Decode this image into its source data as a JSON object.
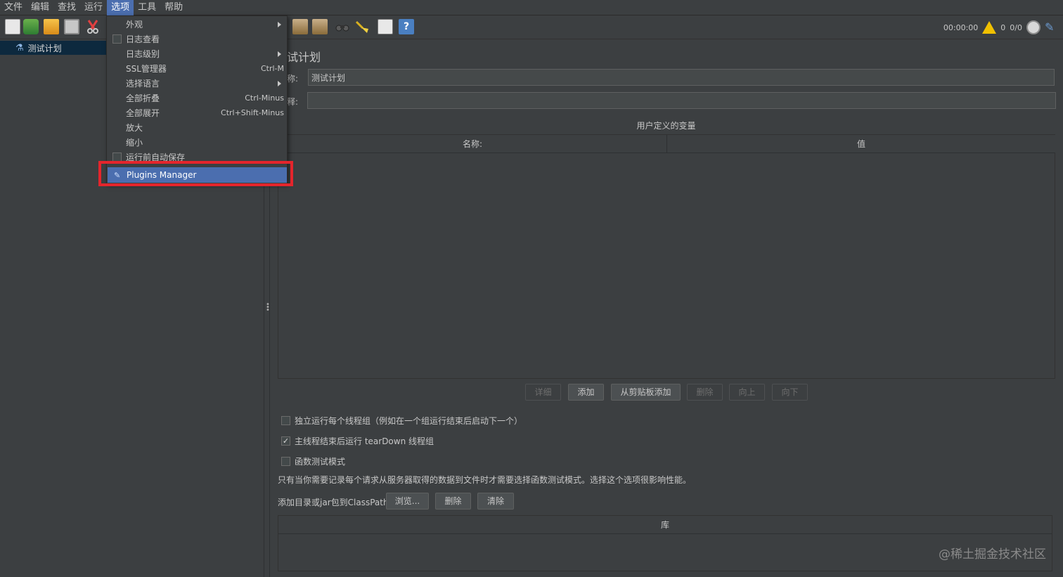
{
  "menubar": [
    "文件",
    "编辑",
    "查找",
    "运行",
    "选项",
    "工具",
    "帮助"
  ],
  "toolbar": {
    "elapsed": "00:00:00",
    "warnings": "0",
    "threads": "0/0",
    "help_glyph": "?"
  },
  "tree": {
    "root": "测试计划"
  },
  "options_menu": {
    "items": [
      {
        "label": "外观",
        "submenu": true
      },
      {
        "label": "日志查看",
        "checkbox": true
      },
      {
        "label": "日志级别",
        "submenu": true
      },
      {
        "label": "SSL管理器",
        "shortcut": "Ctrl-M"
      },
      {
        "label": "选择语言",
        "submenu": true
      },
      {
        "label": "全部折叠",
        "shortcut": "Ctrl-Minus"
      },
      {
        "label": "全部展开",
        "shortcut": "Ctrl+Shift-Minus"
      },
      {
        "label": "放大"
      },
      {
        "label": "缩小"
      },
      {
        "label": "运行前自动保存",
        "checkbox": true
      },
      {
        "label": "Plugins Manager",
        "highlighted": true
      }
    ]
  },
  "panel": {
    "title": "试计划",
    "name_label": "称:",
    "name_value": "测试计划",
    "comment_label": "释:",
    "comment_value": "",
    "vars_title": "用户定义的变量",
    "col_name": "名称:",
    "col_value": "值",
    "buttons": {
      "detail": "详细",
      "add": "添加",
      "add_clipboard": "从剪贴板添加",
      "delete": "删除",
      "up": "向上",
      "down": "向下"
    },
    "chk_independent": "独立运行每个线程组（例如在一个组运行结束后启动下一个）",
    "chk_teardown": "主线程结束后运行 tearDown 线程组",
    "chk_functional": "函数测试模式",
    "functional_note": "只有当你需要记录每个请求从服务器取得的数据到文件时才需要选择函数测试模式。选择这个选项很影响性能。",
    "classpath_label": "添加目录或jar包到ClassPath",
    "browse": "浏览...",
    "cp_delete": "删除",
    "cp_clear": "清除",
    "lib_header": "库"
  },
  "watermark": "@稀土掘金技术社区"
}
